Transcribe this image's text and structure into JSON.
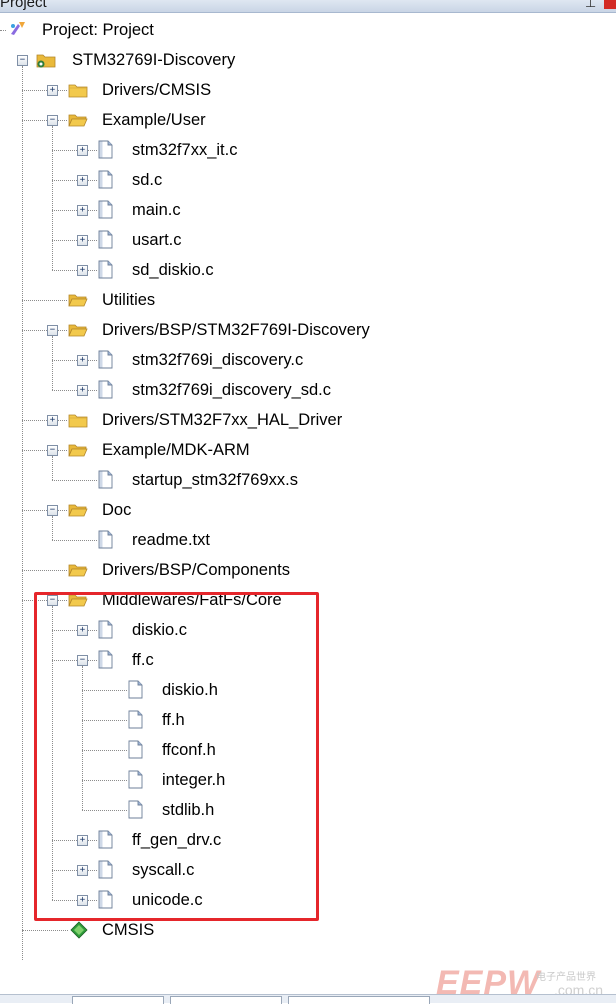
{
  "window": {
    "title": "Project"
  },
  "tree": {
    "root_label": "Project: Project",
    "target_label": "STM32769I-Discovery",
    "items": [
      {
        "label": "Drivers/CMSIS",
        "kind": "folder",
        "expanded": false,
        "depth": 1
      },
      {
        "label": "Example/User",
        "kind": "folder",
        "expanded": true,
        "depth": 1
      },
      {
        "label": "stm32f7xx_it.c",
        "kind": "file",
        "expanded": false,
        "depth": 2
      },
      {
        "label": "sd.c",
        "kind": "file",
        "expanded": false,
        "depth": 2
      },
      {
        "label": "main.c",
        "kind": "file",
        "expanded": false,
        "depth": 2
      },
      {
        "label": "usart.c",
        "kind": "file",
        "expanded": false,
        "depth": 2
      },
      {
        "label": "sd_diskio.c",
        "kind": "file",
        "expanded": false,
        "depth": 2
      },
      {
        "label": "Utilities",
        "kind": "folder",
        "expanded": null,
        "depth": 1
      },
      {
        "label": "Drivers/BSP/STM32F769I-Discovery",
        "kind": "folder",
        "expanded": true,
        "depth": 1
      },
      {
        "label": "stm32f769i_discovery.c",
        "kind": "file",
        "expanded": false,
        "depth": 2
      },
      {
        "label": "stm32f769i_discovery_sd.c",
        "kind": "file",
        "expanded": false,
        "depth": 2
      },
      {
        "label": "Drivers/STM32F7xx_HAL_Driver",
        "kind": "folder",
        "expanded": false,
        "depth": 1
      },
      {
        "label": "Example/MDK-ARM",
        "kind": "folder",
        "expanded": true,
        "depth": 1
      },
      {
        "label": "startup_stm32f769xx.s",
        "kind": "file",
        "expanded": null,
        "depth": 2
      },
      {
        "label": "Doc",
        "kind": "folder",
        "expanded": true,
        "depth": 1
      },
      {
        "label": "readme.txt",
        "kind": "file",
        "expanded": null,
        "depth": 2
      },
      {
        "label": "Drivers/BSP/Components",
        "kind": "folder",
        "expanded": null,
        "depth": 1
      },
      {
        "label": "Middlewares/FatFs/Core",
        "kind": "folder",
        "expanded": true,
        "depth": 1
      },
      {
        "label": "diskio.c",
        "kind": "file",
        "expanded": false,
        "depth": 2
      },
      {
        "label": "ff.c",
        "kind": "file",
        "expanded": true,
        "depth": 2
      },
      {
        "label": "diskio.h",
        "kind": "header",
        "expanded": null,
        "depth": 3
      },
      {
        "label": "ff.h",
        "kind": "header",
        "expanded": null,
        "depth": 3
      },
      {
        "label": "ffconf.h",
        "kind": "header",
        "expanded": null,
        "depth": 3
      },
      {
        "label": "integer.h",
        "kind": "header",
        "expanded": null,
        "depth": 3
      },
      {
        "label": "stdlib.h",
        "kind": "header",
        "expanded": null,
        "depth": 3
      },
      {
        "label": "ff_gen_drv.c",
        "kind": "file",
        "expanded": false,
        "depth": 2
      },
      {
        "label": "syscall.c",
        "kind": "file",
        "expanded": false,
        "depth": 2
      },
      {
        "label": "unicode.c",
        "kind": "file",
        "expanded": false,
        "depth": 2
      }
    ],
    "cmsis_label": "CMSIS"
  },
  "watermark": {
    "brand": "EEPW",
    "tagline": "电子产品世界",
    "domain": ".com.cn"
  },
  "colors": {
    "highlight_box": "#e5262b",
    "folder": "#f2c94c",
    "file_fold": "#9fb6d8"
  }
}
